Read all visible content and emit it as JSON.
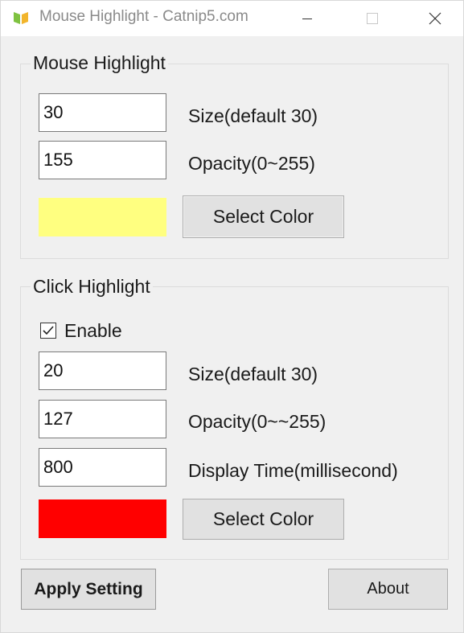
{
  "window": {
    "title": "Mouse Highlight - Catnip5.com",
    "controls": {
      "minimize_icon": "minimize-icon",
      "maximize_icon": "maximize-icon",
      "close_icon": "close-icon"
    }
  },
  "mouse_highlight": {
    "group_title": "Mouse Highlight",
    "size_value": "30",
    "size_label": "Size(default 30)",
    "opacity_value": "155",
    "opacity_label": "Opacity(0~255)",
    "color": "#ffff80",
    "select_color_label": "Select Color"
  },
  "click_highlight": {
    "group_title": "Click Highlight",
    "enable_label": "Enable",
    "enable_checked": true,
    "size_value": "20",
    "size_label": "Size(default 30)",
    "opacity_value": "127",
    "opacity_label": "Opacity(0~~255)",
    "display_time_value": "800",
    "display_time_label": "Display Time(millisecond)",
    "color": "#ff0000",
    "select_color_label": "Select Color"
  },
  "footer": {
    "apply_label": "Apply Setting",
    "about_label": "About"
  }
}
